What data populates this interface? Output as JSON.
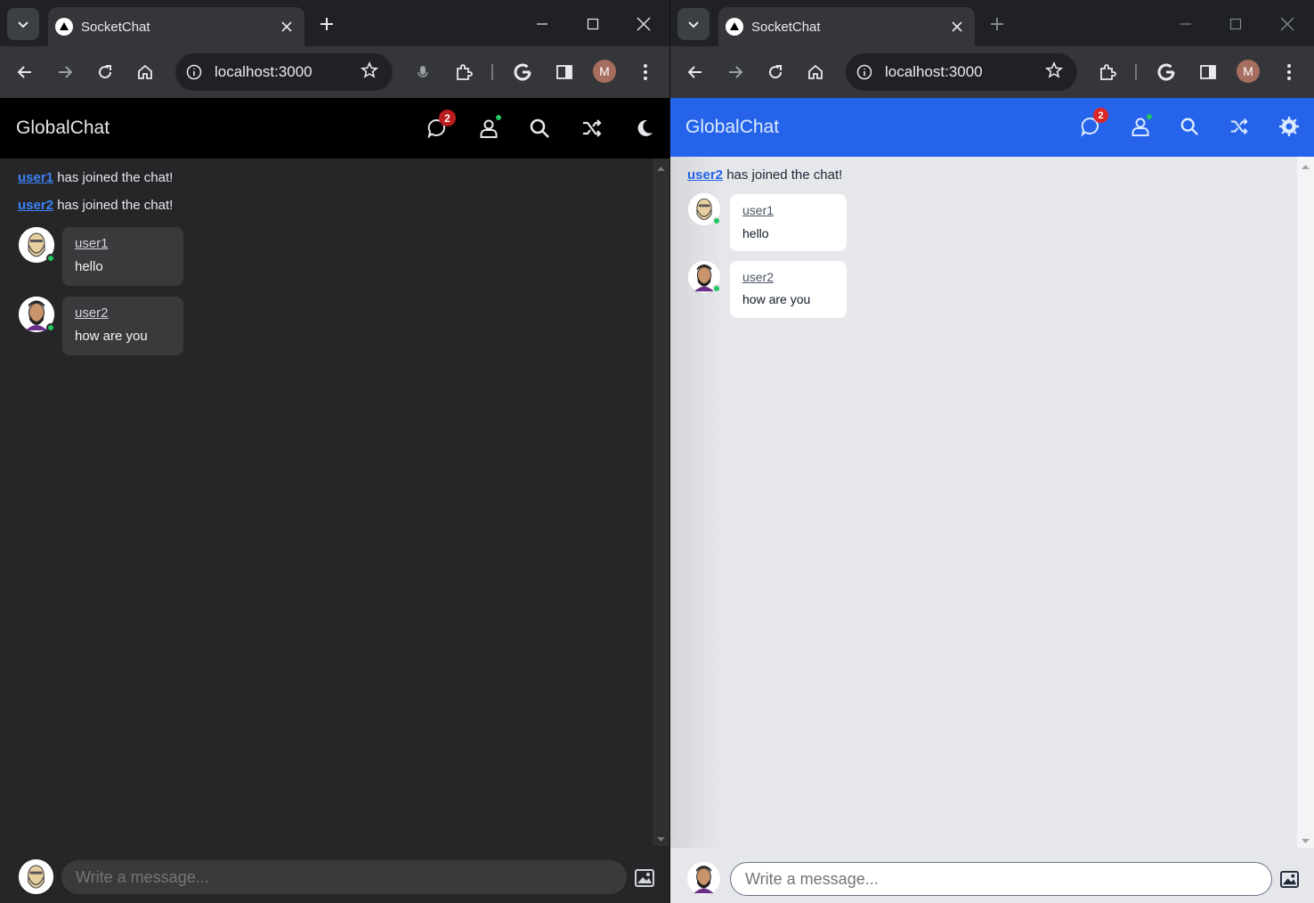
{
  "left": {
    "browser": {
      "tab_title": "SocketChat",
      "url": "localhost:3000",
      "profile_initial": "M"
    },
    "app": {
      "title": "GlobalChat",
      "notification_count": "2",
      "theme_toggle_icon": "moon-icon",
      "notices": [
        {
          "user": "user1",
          "text": "has joined the chat!"
        },
        {
          "user": "user2",
          "text": "has joined the chat!"
        }
      ],
      "messages": [
        {
          "user": "user1",
          "text": "hello"
        },
        {
          "user": "user2",
          "text": "how are you"
        }
      ],
      "input_placeholder": "Write a message..."
    }
  },
  "right": {
    "browser": {
      "tab_title": "SocketChat",
      "url": "localhost:3000",
      "profile_initial": "M"
    },
    "app": {
      "title": "GlobalChat",
      "notification_count": "2",
      "theme_toggle_icon": "sun-icon",
      "notices": [
        {
          "user": "user2",
          "text": "has joined the chat!"
        }
      ],
      "messages": [
        {
          "user": "user1",
          "text": "hello"
        },
        {
          "user": "user2",
          "text": "how are you"
        }
      ],
      "input_placeholder": "Write a message..."
    }
  },
  "colors": {
    "dark_header": "#000000",
    "dark_body": "#262629",
    "dark_bubble": "#3a3a3d",
    "light_header": "#2563eb",
    "light_body": "#e5e7eb",
    "link_blue": "#3b82f6",
    "online_green": "#22c55e",
    "badge_red": "#dc2626"
  }
}
